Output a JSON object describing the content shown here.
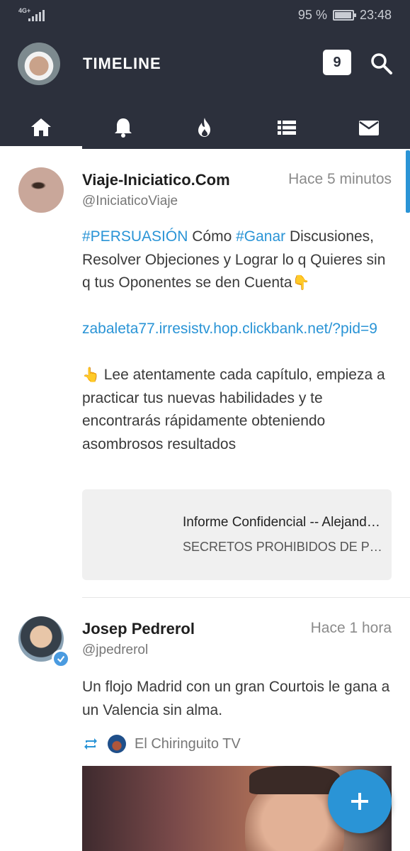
{
  "status_bar": {
    "network": "4G+",
    "battery_percent": "95 %",
    "battery_level": 0.95,
    "time": "23:48"
  },
  "app_bar": {
    "title": "TIMELINE",
    "notification_count": "9",
    "tabs": [
      {
        "name": "home",
        "icon": "home-icon",
        "active": true
      },
      {
        "name": "notifications",
        "icon": "bell-icon",
        "active": false
      },
      {
        "name": "trending",
        "icon": "flame-icon",
        "active": false
      },
      {
        "name": "lists",
        "icon": "list-icon",
        "active": false
      },
      {
        "name": "messages",
        "icon": "mail-icon",
        "active": false
      }
    ]
  },
  "tweets": [
    {
      "name": "Viaje-Iniciatico.Com",
      "handle": "@IniciaticoViaje",
      "time": "Hace 5 minutos",
      "hashtag_1": "#PERSUASIÓN",
      "text_1": " Cómo ",
      "hashtag_2": "#Ganar",
      "text_2": " Discusiones, Resolver Objeciones y Lograr lo q Quieres sin q tus Oponentes se den Cuenta",
      "emoji_1": "👇",
      "link": "zabaleta77.irresistv.hop.clickbank.net/?pid=9",
      "emoji_2": "👆",
      "text_3": " Lee atentamente cada capítulo, empieza a practicar tus nuevas habilidades y te encontrarás rápidamente obteniendo asombrosos resultados",
      "card": {
        "title": "Informe Confidencial -- Alejandro Zabaleta",
        "subtitle": "SECRETOS PROHIBIDOS DE PERSUASIÓN"
      }
    },
    {
      "name": "Josep Pedrerol",
      "handle": "@jpedrerol",
      "time": "Hace 1 hora",
      "verified": true,
      "text": "Un flojo Madrid con un gran Courtois le gana a un Valencia sin alma.",
      "retweeted_from": "El Chiringuito TV"
    }
  ],
  "colors": {
    "bar_background": "#2c303c",
    "accent": "#2a94d6"
  }
}
